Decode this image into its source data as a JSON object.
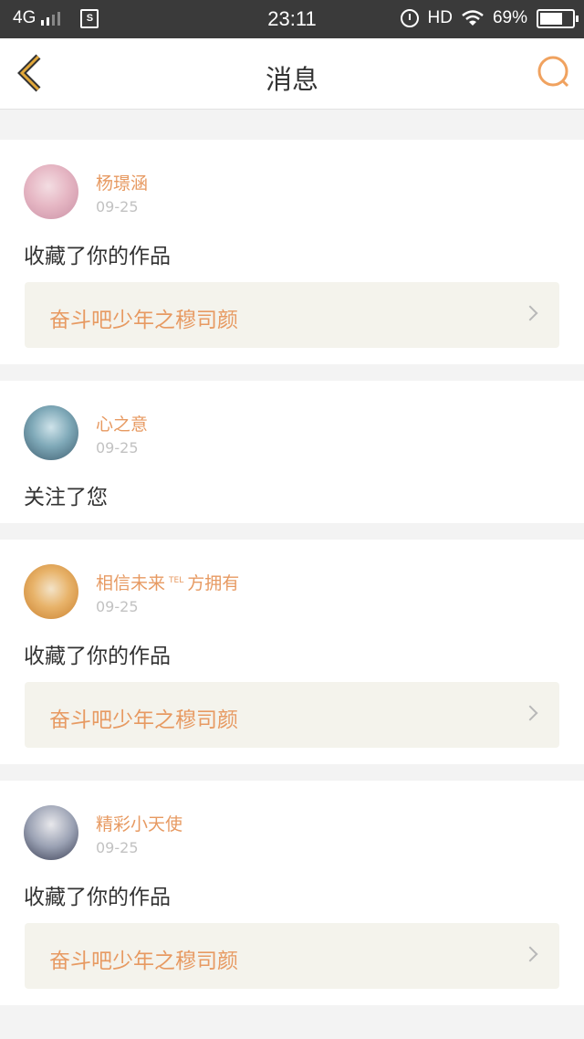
{
  "status_bar": {
    "network": "4G",
    "time": "23:11",
    "hd": "HD",
    "battery": "69%"
  },
  "nav": {
    "title": "消息"
  },
  "messages": [
    {
      "user": "杨璟涵",
      "date": "09-25",
      "action": "收藏了你的作品",
      "work": "奋斗吧少年之穆司颜"
    },
    {
      "user": "心之意",
      "date": "09-25",
      "action": "关注了您"
    },
    {
      "user": "相信未来",
      "user_sup": "TEL",
      "user_suffix": "方拥有",
      "date": "09-25",
      "action": "收藏了你的作品",
      "work": "奋斗吧少年之穆司颜"
    },
    {
      "user": "精彩小天使",
      "date": "09-25",
      "action": "收藏了你的作品",
      "work": "奋斗吧少年之穆司颜"
    }
  ],
  "colors": {
    "accent": "#e79a62",
    "back_arrow": "#e2a83a",
    "page_bg": "#f3f3f3",
    "work_box_bg": "#f4f3ec"
  }
}
